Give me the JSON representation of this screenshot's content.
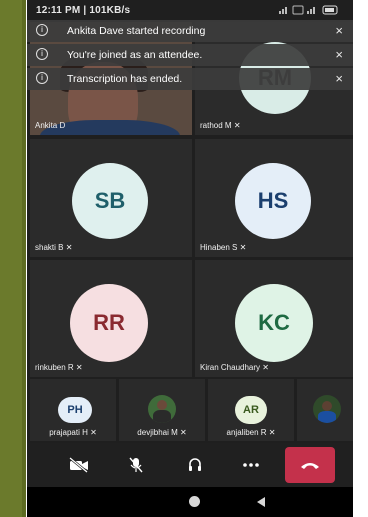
{
  "status_bar": {
    "time": "12:11 PM | 101KB/s",
    "system_icons": "signal-wifi-battery"
  },
  "notifications": [
    {
      "message": "Ankita Dave started recording",
      "icon": "info-icon",
      "close": "×"
    },
    {
      "message": "You're joined as an attendee.",
      "icon": "info-icon",
      "close": "×"
    },
    {
      "message": "Transcription has ended.",
      "icon": "info-icon",
      "close": "×"
    }
  ],
  "grid": [
    {
      "name": "Ankita D",
      "type": "video"
    },
    {
      "name": "rathod M",
      "initials": "RM",
      "muted": true,
      "avatar_bg": "#d9ece7",
      "avatar_fg": "#4a4a4a"
    },
    {
      "name": "shakti B",
      "initials": "SB",
      "muted": true,
      "avatar_bg": "#dff0ee",
      "avatar_fg": "#1f5f6a"
    },
    {
      "name": "Hinaben S",
      "initials": "HS",
      "muted": true,
      "avatar_bg": "#e4eef8",
      "avatar_fg": "#1b3f6e"
    },
    {
      "name": "rinkuben R",
      "initials": "RR",
      "muted": true,
      "avatar_bg": "#f6dfe1",
      "avatar_fg": "#8a2a30"
    },
    {
      "name": "Kiran Chaudhary",
      "initials": "KC",
      "muted": true,
      "avatar_bg": "#dff3e6",
      "avatar_fg": "#1e6a42"
    }
  ],
  "strip": [
    {
      "name": "prajapati H",
      "initials": "PH",
      "muted": true,
      "avatar_bg": "#e4eef8",
      "avatar_fg": "#1b3f6e"
    },
    {
      "name": "devjibhai M",
      "type": "photo",
      "muted": true
    },
    {
      "name": "anjaliben R",
      "initials": "AR",
      "muted": true,
      "avatar_bg": "#e8f2dc",
      "avatar_fg": "#3a5a1e"
    },
    {
      "name": "",
      "type": "photo"
    }
  ],
  "controls": {
    "camera": "camera-off-icon",
    "mic": "mic-off-icon",
    "audio": "headset-icon",
    "more": "more-icon",
    "end": "hang-up-icon"
  },
  "nav": {
    "home": "home-icon",
    "back": "back-icon"
  },
  "colors": {
    "end_call": "#c4314b",
    "background": "#1f1f1f",
    "tile": "#2b2b2b"
  }
}
